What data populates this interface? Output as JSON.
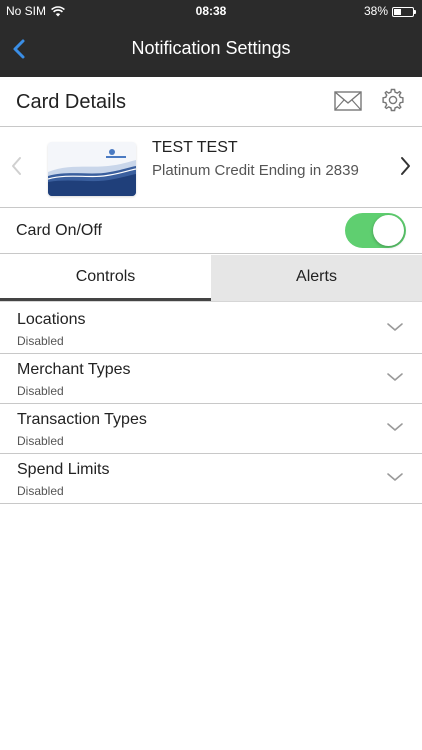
{
  "status_bar": {
    "carrier": "No SIM",
    "time": "08:38",
    "battery_percent": "38%",
    "battery_level": 0.38
  },
  "nav": {
    "title": "Notification Settings",
    "back_icon": "chevron-left-icon"
  },
  "card_details": {
    "label": "Card Details",
    "mail_icon": "envelope-icon",
    "settings_icon": "gear-icon"
  },
  "card": {
    "name": "TEST TEST",
    "description": "Platinum Credit Ending in 2839"
  },
  "card_toggle": {
    "label": "Card On/Off",
    "on": true
  },
  "tabs": [
    {
      "label": "Controls",
      "active": true
    },
    {
      "label": "Alerts",
      "active": false
    }
  ],
  "controls": [
    {
      "title": "Locations",
      "status": "Disabled"
    },
    {
      "title": "Merchant Types",
      "status": "Disabled"
    },
    {
      "title": "Transaction Types",
      "status": "Disabled"
    },
    {
      "title": "Spend Limits",
      "status": "Disabled"
    }
  ],
  "colors": {
    "bar_background": "#2b2b2b",
    "accent_blue": "#3a8ee6",
    "toggle_on": "#5fcf70",
    "inactive_tab": "#e6e6e6"
  }
}
